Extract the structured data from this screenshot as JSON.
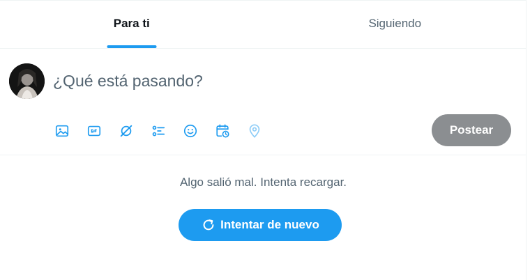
{
  "tabs": [
    {
      "label": "Para ti",
      "active": true
    },
    {
      "label": "Siguiendo",
      "active": false
    }
  ],
  "composer": {
    "placeholder": "¿Qué está pasando?",
    "avatar_icon": "user-avatar",
    "toolbar_icons": [
      "media-icon",
      "gif-icon",
      "grok-icon",
      "poll-icon",
      "emoji-icon",
      "schedule-icon",
      "location-icon"
    ],
    "post_label": "Postear"
  },
  "error": {
    "message": "Algo salió mal. Intenta recargar.",
    "retry_label": "Intentar de nuevo",
    "retry_icon": "refresh-icon"
  },
  "colors": {
    "accent": "#1d9bf0",
    "post_disabled": "#8b8e91",
    "secondary_text": "#536471",
    "border": "#eff3f4"
  }
}
